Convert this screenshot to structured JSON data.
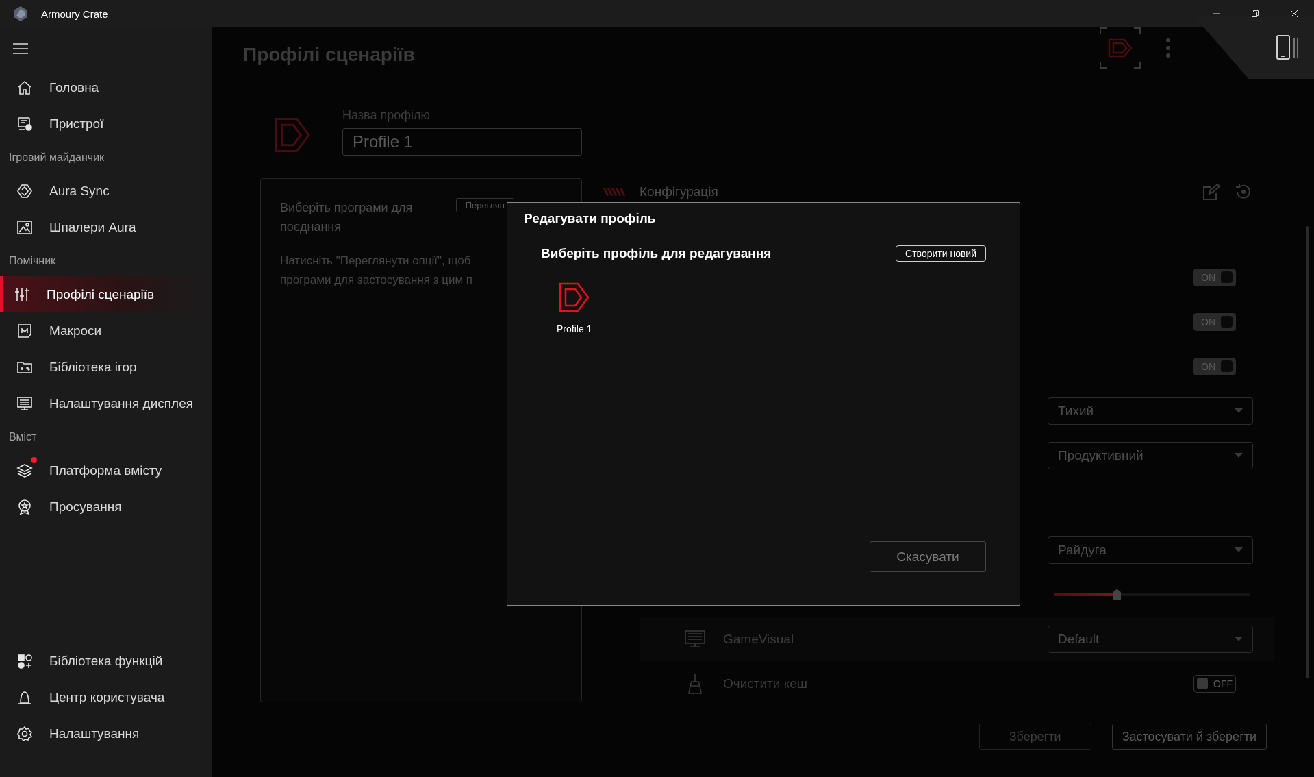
{
  "window": {
    "title": "Armoury Crate"
  },
  "sidebar": {
    "items": [
      {
        "kind": "item",
        "label": "Головна",
        "selected": false,
        "notification": false
      },
      {
        "kind": "item",
        "label": "Пристрої",
        "selected": false,
        "notification": false
      },
      {
        "kind": "section",
        "label": "Ігровий майданчик"
      },
      {
        "kind": "item",
        "label": "Aura Sync",
        "selected": false,
        "notification": false
      },
      {
        "kind": "item",
        "label": "Шпалери Aura",
        "selected": false,
        "notification": false
      },
      {
        "kind": "section",
        "label": "Помічник"
      },
      {
        "kind": "item",
        "label": "Профілі сценаріїв",
        "selected": true,
        "notification": false
      },
      {
        "kind": "item",
        "label": "Макроси",
        "selected": false,
        "notification": false
      },
      {
        "kind": "item",
        "label": "Бібліотека ігор",
        "selected": false,
        "notification": false
      },
      {
        "kind": "item",
        "label": "Налаштування дисплея",
        "selected": false,
        "notification": false
      },
      {
        "kind": "section",
        "label": "Вміст"
      },
      {
        "kind": "item",
        "label": "Платформа вмісту",
        "selected": false,
        "notification": true
      },
      {
        "kind": "item",
        "label": "Просування",
        "selected": false,
        "notification": false
      }
    ],
    "bottom_items": [
      {
        "kind": "item",
        "label": "Бібліотека функцій",
        "selected": false,
        "notification": false
      },
      {
        "kind": "item",
        "label": "Центр користувача",
        "selected": false,
        "notification": false
      },
      {
        "kind": "item",
        "label": "Налаштування",
        "selected": false,
        "notification": false
      }
    ]
  },
  "page": {
    "title": "Профілі сценаріїв"
  },
  "profile": {
    "label": "Назва профілю",
    "value": "Profile 1"
  },
  "apps_card": {
    "title": "Виберіть програми для поєднання",
    "button": "Переглян",
    "hint_lines": [
      "Натисніть \"Переглянути опції\", щоб",
      "програми для застосування з цим п"
    ]
  },
  "config": {
    "title": "Конфігурація",
    "rows": [
      {
        "kind": "toggle",
        "on": true,
        "text": "ON"
      },
      {
        "kind": "toggle",
        "on": true,
        "text": "ON"
      },
      {
        "kind": "toggle",
        "on": true,
        "text": "ON"
      },
      {
        "kind": "dropdown",
        "value": "Тихий"
      },
      {
        "kind": "dropdown",
        "value": "Продуктивний"
      },
      {
        "kind": "dropdown",
        "value": "Райдуга"
      },
      {
        "kind": "slider",
        "level": 0.32
      },
      {
        "kind": "dropdown",
        "label": "GameVisual",
        "value": "Default"
      },
      {
        "kind": "toggle",
        "label": "Очистити кеш",
        "on": false,
        "text": "OFF"
      }
    ]
  },
  "buttons": [
    {
      "label": "Зберегти",
      "disabled": true
    },
    {
      "label": "Застосувати й зберегти",
      "disabled": false
    }
  ],
  "dialog": {
    "title": "Редагувати профіль",
    "subtitle": "Виберіть профіль для редагування",
    "create_button": "Створити новий",
    "profiles": [
      {
        "name": "Profile 1"
      }
    ],
    "cancel_button": "Скасувати"
  }
}
